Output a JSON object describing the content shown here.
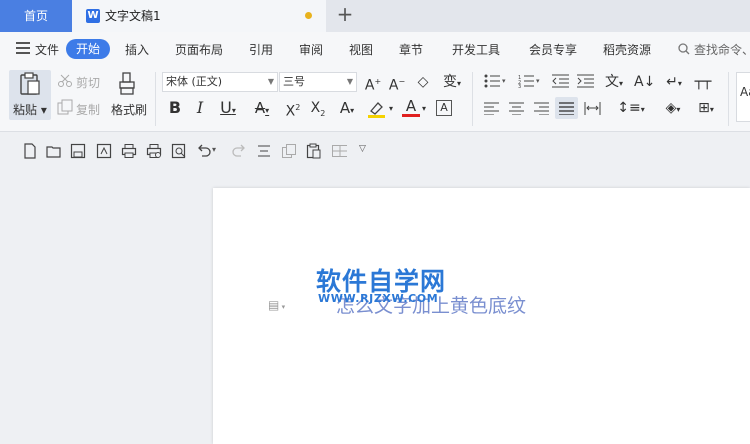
{
  "tabs": {
    "home": "首页",
    "document": "文字文稿1",
    "add": "+"
  },
  "menu": {
    "file": "文件",
    "items": [
      "开始",
      "插入",
      "页面布局",
      "引用",
      "审阅",
      "视图",
      "章节",
      "开发工具",
      "会员专享",
      "稻壳资源"
    ],
    "search_placeholder": "查找命令、"
  },
  "ribbon": {
    "paste": "粘贴",
    "cut": "剪切",
    "copy": "复制",
    "format_painter": "格式刷",
    "font_name": "宋体 (正文)",
    "font_size": "三号",
    "style_preview": "Aa"
  },
  "document": {
    "text": "怎么文字加上黄色底纹",
    "watermark_title": "软件自学网",
    "watermark_url": "WWW.RJZXW.COM"
  },
  "colors": {
    "accent": "#3d7be8",
    "home_tab": "#4a7fe2",
    "unsaved_dot": "#e8b21d",
    "watermark": "#2b78d6"
  }
}
